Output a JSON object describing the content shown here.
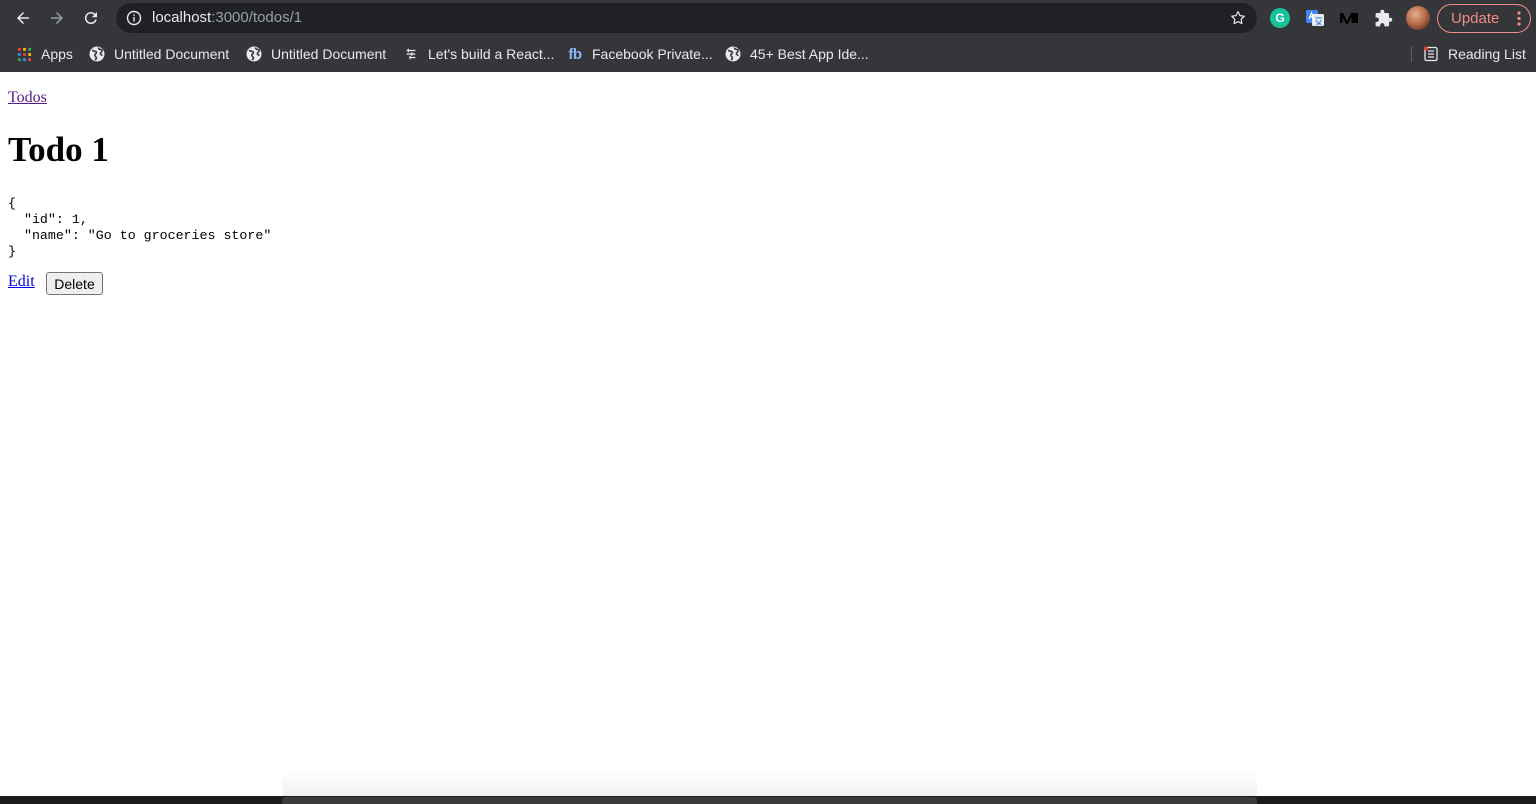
{
  "browser": {
    "url_host": "localhost",
    "url_path": ":3000/todos/1",
    "update_label": "Update",
    "bookmarks": [
      {
        "label": "Apps",
        "icon": "apps-grid-icon"
      },
      {
        "label": "Untitled Document",
        "icon": "globe-icon"
      },
      {
        "label": "Untitled Document",
        "icon": "globe-icon"
      },
      {
        "label": "Let's build a React...",
        "icon": "bookmark-favicon-icon"
      },
      {
        "label": "Facebook Private...",
        "icon": "fb-icon"
      },
      {
        "label": "45+ Best App Ide...",
        "icon": "globe-icon"
      }
    ],
    "reading_list_label": "Reading List",
    "extensions": {
      "grammarly_letter": "G"
    },
    "fb_text": "fb"
  },
  "page": {
    "back_link": "Todos",
    "title": "Todo 1",
    "json_text": "{\n  \"id\": 1,\n  \"name\": \"Go to groceries store\"\n}",
    "edit_label": "Edit",
    "delete_label": "Delete"
  },
  "colors": {
    "chrome_bg": "#35363a",
    "omnibox_bg": "#202124",
    "update_accent": "#f28b82",
    "visited_link": "#551a8b",
    "link": "#0000ee"
  }
}
